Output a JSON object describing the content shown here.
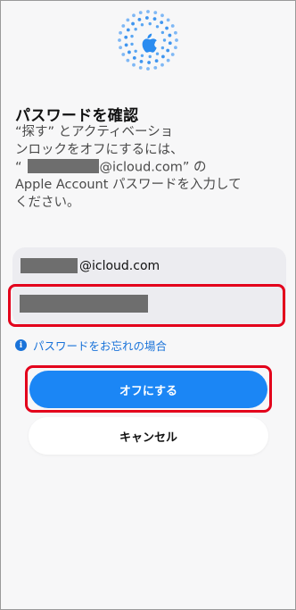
{
  "dialog": {
    "icon": "apple-logo-icon",
    "title": "パスワードを確認",
    "description_lines": [
      "“探す” とアクティベーショ",
      "ンロックをオフにするには、",
      "@icloud.com” の",
      "Apple Account パスワードを入力して",
      "ください。"
    ],
    "description_quote_open": "“"
  },
  "form": {
    "account_suffix": "@icloud.com",
    "forgot_password_link": "パスワードをお忘れの場合",
    "info_icon": "info-icon"
  },
  "actions": {
    "turn_off_label": "オフにする",
    "cancel_label": "キャンセル"
  },
  "colors": {
    "accent_blue": "#1b86f5",
    "link_blue": "#1a73d9",
    "highlight_red": "#e3001b",
    "redaction_gray": "#6e6e6e"
  }
}
